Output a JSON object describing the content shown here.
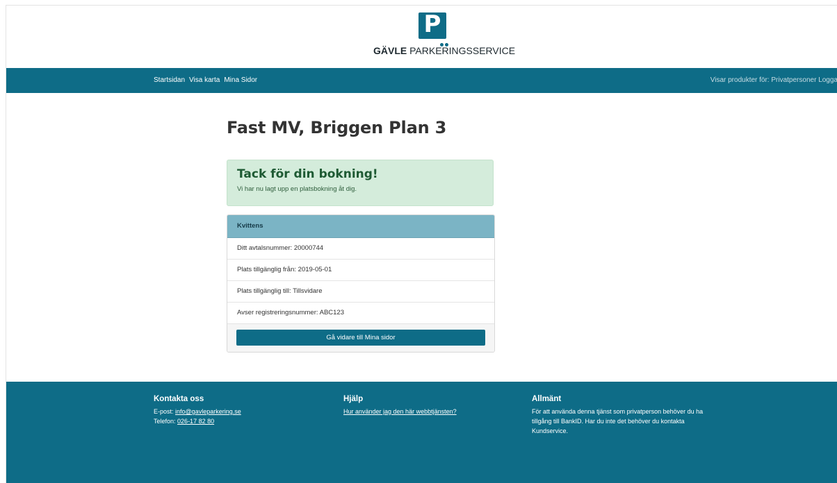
{
  "header": {
    "logo_letter": "P",
    "logo_brand_bold": "GÄVLE",
    "logo_brand_rest": "PARKERINGSSERVICE"
  },
  "nav": {
    "items": [
      "Startsidan",
      "Visa karta",
      "Mina Sidor"
    ],
    "right_text": "Visar produkter för: Privatpersoner",
    "login": "Logga"
  },
  "main": {
    "title": "Fast MV, Briggen Plan 3",
    "alert": {
      "title": "Tack för din bokning!",
      "text": "Vi har nu lagt upp en platsbokning åt dig."
    },
    "receipt": {
      "heading": "Kvittens",
      "rows": [
        "Ditt avtalsnummer: 20000744",
        "Plats tillgänglig från: 2019-05-01",
        "Plats tillgänglig till: Tillsvidare",
        "Avser registreringsnummer: ABC123"
      ],
      "button": "Gå vidare till Mina sidor"
    }
  },
  "footer": {
    "contact": {
      "heading": "Kontakta oss",
      "email_label": "E-post:",
      "email": "info@gavleparkering.se",
      "phone_label": "Telefon:",
      "phone": "026-17 82 80"
    },
    "help": {
      "heading": "Hjälp",
      "link": "Hur använder jag den här webbtjänsten?"
    },
    "general": {
      "heading": "Allmänt",
      "text": "För att använda denna tjänst som privatperson behöver du ha tillgång till BankID. Har du inte det behöver du kontakta Kundservice."
    }
  },
  "colors": {
    "brand": "#0e6c87",
    "success_bg": "#d4ecdb",
    "panel_head": "#7bb4c5"
  }
}
